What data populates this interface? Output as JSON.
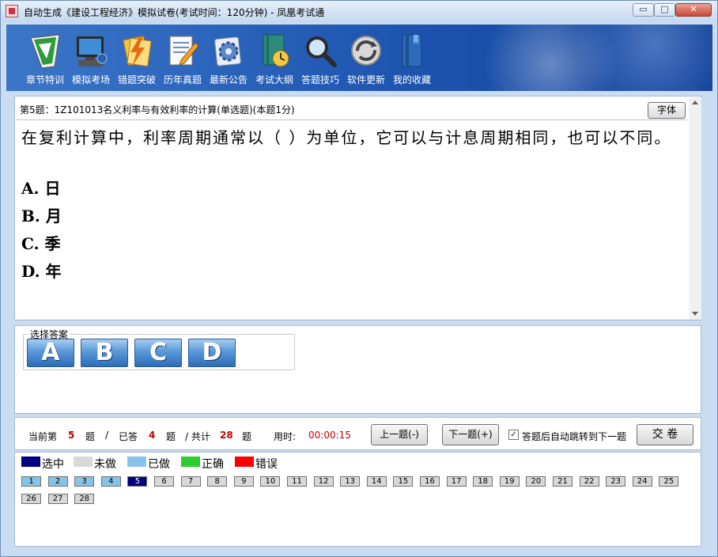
{
  "window": {
    "title": "自动生成《建设工程经济》模拟试卷(考试时间：120分钟) - 凤凰考试通",
    "min_glyph": "▭",
    "max_glyph": "□",
    "close_glyph": "✕"
  },
  "toolbar": {
    "items": [
      {
        "label": "章节特训",
        "icon": "certificate-icon"
      },
      {
        "label": "模拟考场",
        "icon": "computer-icon"
      },
      {
        "label": "错题突破",
        "icon": "lightning-icon"
      },
      {
        "label": "历年真题",
        "icon": "document-edit-icon"
      },
      {
        "label": "最新公告",
        "icon": "gear-icon"
      },
      {
        "label": "考试大纲",
        "icon": "book-clock-icon"
      },
      {
        "label": "答题技巧",
        "icon": "magnifier-icon"
      },
      {
        "label": "软件更新",
        "icon": "refresh-icon"
      },
      {
        "label": "我的收藏",
        "icon": "bookmark-book-icon"
      }
    ]
  },
  "question": {
    "header": "第5题：1Z101013名义利率与有效利率的计算(单选题)(本题1分)",
    "font_button": "字体",
    "text": "在复利计算中，利率周期通常以（ ）为单位，它可以与计息周期相同，也可以不同。",
    "options": [
      "A. 日",
      "B. 月",
      "C. 季",
      "D. 年"
    ]
  },
  "answer": {
    "legend": "选择答案",
    "buttons": [
      "A",
      "B",
      "C",
      "D"
    ]
  },
  "status": {
    "current_prefix": "当前第",
    "current": "5",
    "current_suffix": "题",
    "slash1": "/",
    "answered_prefix": "已答",
    "answered": "4",
    "answered_suffix": "题",
    "total_prefix": "/ 共计",
    "total": "28",
    "total_suffix": "题",
    "time_label": "用时:",
    "time": "00:00:15",
    "prev_button": "上一题(-)",
    "next_button": "下一题(+)",
    "auto_jump_label": "答题后自动跳转到下一题",
    "auto_jump_checked": true,
    "submit_button": "交 卷"
  },
  "legend": [
    {
      "label": "选中",
      "color": "#000080"
    },
    {
      "label": "未做",
      "color": "#d8d8d8"
    },
    {
      "label": "已做",
      "color": "#87c3e8"
    },
    {
      "label": "正确",
      "color": "#2ecc2e"
    },
    {
      "label": "错误",
      "color": "#ff0000"
    }
  ],
  "questions": {
    "numbers": [
      "1",
      "2",
      "3",
      "4",
      "5",
      "6",
      "7",
      "8",
      "9",
      "10",
      "11",
      "12",
      "13",
      "14",
      "15",
      "16",
      "17",
      "18",
      "19",
      "20",
      "21",
      "22",
      "23",
      "24",
      "25",
      "26",
      "27",
      "28"
    ],
    "states": [
      "done",
      "done",
      "done",
      "done",
      "selected",
      "todo",
      "todo",
      "todo",
      "todo",
      "todo",
      "todo",
      "todo",
      "todo",
      "todo",
      "todo",
      "todo",
      "todo",
      "todo",
      "todo",
      "todo",
      "todo",
      "todo",
      "todo",
      "todo",
      "todo",
      "todo",
      "todo",
      "todo"
    ]
  }
}
